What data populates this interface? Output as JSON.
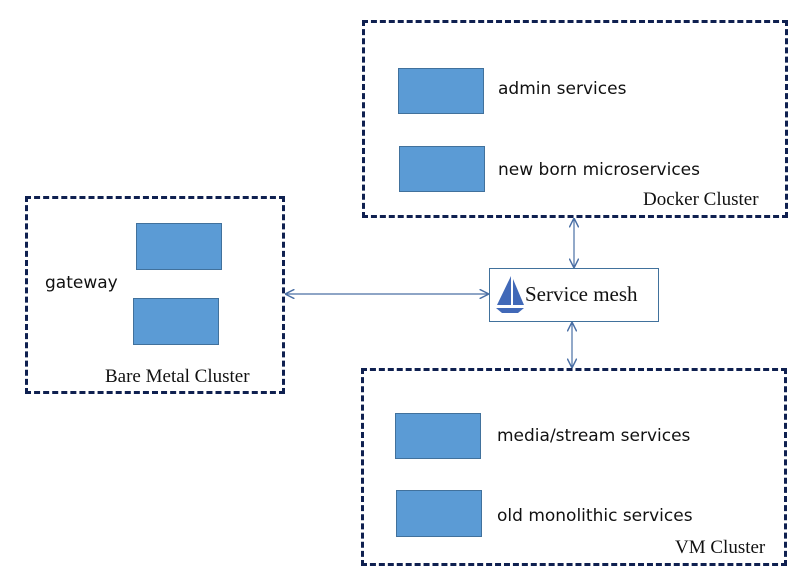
{
  "clusters": {
    "docker": {
      "title": "Docker Cluster",
      "services": [
        "admin services",
        "new born microservices"
      ]
    },
    "bare_metal": {
      "title": "Bare Metal Cluster",
      "gateway_label": "gateway"
    },
    "vm": {
      "title": "VM Cluster",
      "services": [
        "media/stream services",
        "old monolithic services"
      ]
    }
  },
  "service_mesh": {
    "label": "Service mesh",
    "icon": "sailboat-icon"
  },
  "connections": [
    {
      "from": "bare_metal",
      "to": "service_mesh",
      "type": "bidirectional"
    },
    {
      "from": "docker",
      "to": "service_mesh",
      "type": "bidirectional"
    },
    {
      "from": "vm",
      "to": "service_mesh",
      "type": "bidirectional"
    }
  ],
  "colors": {
    "service_fill": "#5b9bd5",
    "cluster_border": "#0f2050",
    "connector": "#4a6fa5"
  }
}
